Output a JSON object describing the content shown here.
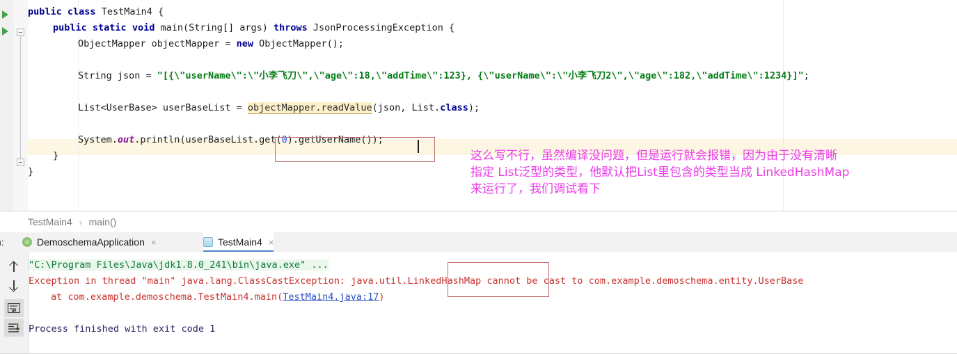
{
  "editor": {
    "code_lines": [
      {
        "indent": 0,
        "segments": [
          {
            "t": "public ",
            "c": "kw"
          },
          {
            "t": "class ",
            "c": "kw"
          },
          {
            "t": "TestMain4 {",
            "c": "plain"
          }
        ]
      },
      {
        "indent": 36,
        "segments": [
          {
            "t": "public ",
            "c": "kw"
          },
          {
            "t": "static ",
            "c": "kw"
          },
          {
            "t": "void ",
            "c": "kw"
          },
          {
            "t": "main(String[] args) ",
            "c": "plain"
          },
          {
            "t": "throws ",
            "c": "kw"
          },
          {
            "t": "JsonProcessingException {",
            "c": "plain"
          }
        ]
      },
      {
        "indent": 72,
        "segments": [
          {
            "t": "ObjectMapper objectMapper = ",
            "c": "plain"
          },
          {
            "t": "new ",
            "c": "kw"
          },
          {
            "t": "ObjectMapper();",
            "c": "plain"
          }
        ]
      },
      {
        "indent": 0,
        "segments": []
      },
      {
        "indent": 72,
        "segments": [
          {
            "t": "String json = ",
            "c": "plain"
          },
          {
            "t": "\"[{\\\"userName\\\":\\\"小李飞刀\\\",\\\"age\\\":18,\\\"addTime\\\":123}, {\\\"userName\\\":\\\"小李飞刀2\\\",\\\"age\\\":182,\\\"addTime\\\":1234}]\"",
            "c": "str"
          },
          {
            "t": ";",
            "c": "plain"
          }
        ]
      },
      {
        "indent": 0,
        "segments": []
      },
      {
        "indent": 72,
        "segments": [
          {
            "t": "List<UserBase> userBaseList = ",
            "c": "plain"
          },
          {
            "t": "objectMapper.readValue",
            "c": "hl"
          },
          {
            "t": "(json, List.",
            "c": "plain"
          },
          {
            "t": "class",
            "c": "kw"
          },
          {
            "t": ");",
            "c": "plain"
          }
        ]
      },
      {
        "indent": 0,
        "segments": []
      },
      {
        "indent": 72,
        "segments": [
          {
            "t": "System.",
            "c": "plain"
          },
          {
            "t": "out",
            "c": "fld"
          },
          {
            "t": ".println(userBaseList.get(",
            "c": "plain"
          },
          {
            "t": "0",
            "c": "num"
          },
          {
            "t": ").getUserName());",
            "c": "plain"
          }
        ]
      },
      {
        "indent": 36,
        "segments": [
          {
            "t": "}",
            "c": "plain"
          }
        ]
      },
      {
        "indent": 0,
        "segments": [
          {
            "t": "}",
            "c": "plain"
          }
        ]
      }
    ]
  },
  "annotation": {
    "color": "#ec3ce8",
    "lines": [
      "这么写不行，虽然编译没问题，但是运行就会报错，因为由于没有清晰",
      "指定 List泛型的类型，他默认把List里包含的类型当成 LinkedHashMap",
      "来运行了，我们调试看下"
    ]
  },
  "breadcrumb": {
    "items": [
      "TestMain4",
      "main()"
    ],
    "separator": "›"
  },
  "run_window": {
    "label": "n:",
    "tabs": [
      {
        "title": "DemoschemaApplication",
        "icon": "spring-boot-icon",
        "close": "×",
        "active": false
      },
      {
        "title": "TestMain4",
        "icon": "java-class-icon",
        "close": "×",
        "active": true
      }
    ],
    "toolbar": [
      {
        "name": "up-arrow-icon",
        "label": "↑",
        "pressed": false
      },
      {
        "name": "down-arrow-icon",
        "label": "↓",
        "pressed": false
      },
      {
        "name": "soft-wrap-icon",
        "label": "",
        "pressed": true
      },
      {
        "name": "scroll-to-end-icon",
        "label": "",
        "pressed": true
      }
    ],
    "console_lines": [
      {
        "indent": 0,
        "segments": [
          {
            "t": "\"C:\\Program Files\\Java\\jdk1.8.0_241\\bin\\java.exe\" ...",
            "c": "c-cmd"
          }
        ]
      },
      {
        "indent": 0,
        "segments": [
          {
            "t": "Exception in thread \"main\" java.lang.ClassCastException: java.util.LinkedHashMap cannot be cast to com.example.demoschema.entity.UserBase",
            "c": "c-err"
          }
        ]
      },
      {
        "indent": 32,
        "segments": [
          {
            "t": "at com.example.demoschema.TestMain4.main(",
            "c": "c-err"
          },
          {
            "t": "TestMain4.java:17",
            "c": "c-link"
          },
          {
            "t": ")",
            "c": "c-err"
          }
        ]
      },
      {
        "indent": 0,
        "segments": []
      },
      {
        "indent": 0,
        "segments": [
          {
            "t": "Process finished with exit code 1",
            "c": "c-ok"
          }
        ]
      }
    ]
  },
  "colors": {
    "keyword": "#00008f",
    "string": "#067d17",
    "number": "#1750eb",
    "field": "#871094",
    "error": "#c7312c",
    "command": "#0b7a3e",
    "link": "#2c4fc7",
    "annotation": "#ec3ce8",
    "highlight_line": "#fdf6e3",
    "readvalue_highlight": "#fdf0c9",
    "red_box_border": "#c06b6b",
    "active_tab_underline": "#4a86c8"
  }
}
